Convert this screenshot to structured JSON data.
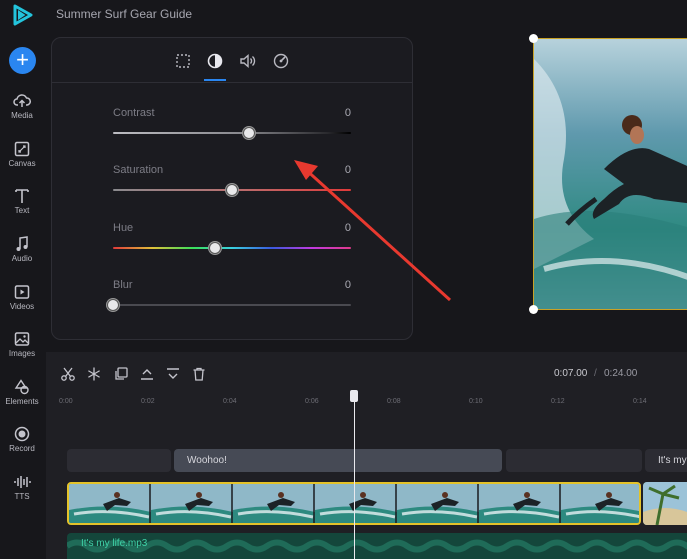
{
  "app": {
    "project_title": "Summer Surf Gear Guide"
  },
  "sidebar": {
    "add_label": "+",
    "items": [
      {
        "label": "Media",
        "icon": "cloud-upload-icon"
      },
      {
        "label": "Canvas",
        "icon": "canvas-icon"
      },
      {
        "label": "Text",
        "icon": "text-icon"
      },
      {
        "label": "Audio",
        "icon": "music-note-icon"
      },
      {
        "label": "Videos",
        "icon": "video-icon"
      },
      {
        "label": "Images",
        "icon": "image-icon"
      },
      {
        "label": "Elements",
        "icon": "shapes-icon"
      },
      {
        "label": "Record",
        "icon": "record-icon"
      },
      {
        "label": "TTS",
        "icon": "waveform-icon"
      }
    ]
  },
  "adjust_panel": {
    "tabs": [
      "crop-grid-icon",
      "contrast-icon",
      "volume-icon",
      "speed-icon"
    ],
    "active_tab": 1,
    "sliders": [
      {
        "label": "Contrast",
        "value": "0",
        "level": 0.57
      },
      {
        "label": "Saturation",
        "value": "0",
        "level": 0.5
      },
      {
        "label": "Hue",
        "value": "0",
        "level": 0.43
      },
      {
        "label": "Blur",
        "value": "0",
        "level": 0.0
      }
    ]
  },
  "timeline": {
    "current_time": "0:07.00",
    "separator": "/",
    "total_time": "0:24.00",
    "ticks": [
      "0:00",
      "0:02",
      "0:04",
      "0:06",
      "0:08",
      "0:10",
      "0:12",
      "0:14"
    ],
    "text_clips": [
      "Woohoo!",
      "It's my"
    ],
    "audio_clip": "It's my life.mp3"
  },
  "colors": {
    "accent": "#2a86f0",
    "selection": "#e4c32a",
    "audio": "#3fd0a6",
    "annotation_arrow": "#e8392f"
  }
}
